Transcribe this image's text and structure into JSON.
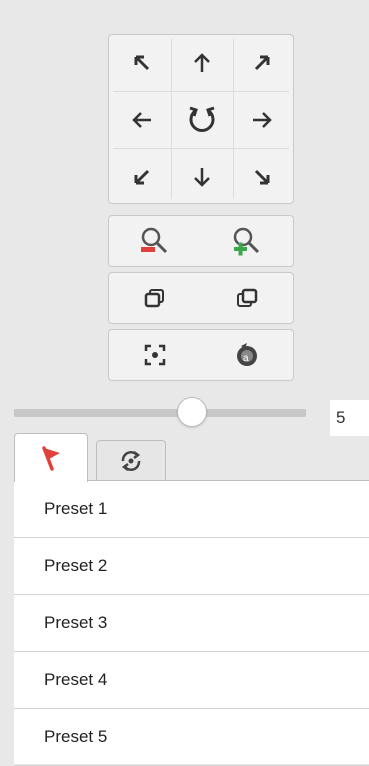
{
  "ptz": {
    "directions": [
      {
        "name": "up-left"
      },
      {
        "name": "up"
      },
      {
        "name": "up-right"
      },
      {
        "name": "left"
      },
      {
        "name": "auto-rotate"
      },
      {
        "name": "right"
      },
      {
        "name": "down-left"
      },
      {
        "name": "down"
      },
      {
        "name": "down-right"
      }
    ],
    "zoom": [
      "zoom-out-icon",
      "zoom-in-icon"
    ],
    "focus": [
      "focus-near-icon",
      "focus-far-icon"
    ],
    "iris": [
      "iris-open-icon",
      "iris-close-icon"
    ],
    "accent_red": "#e0413b",
    "accent_green": "#3aa84a"
  },
  "speed": {
    "value": "5",
    "fraction": 0.61
  },
  "tabs": [
    {
      "icon": "red-flag-icon",
      "active": true
    },
    {
      "icon": "patrol-icon",
      "active": false
    }
  ],
  "presets": [
    {
      "label": "Preset 1"
    },
    {
      "label": "Preset 2"
    },
    {
      "label": "Preset 3"
    },
    {
      "label": "Preset 4"
    },
    {
      "label": "Preset 5"
    }
  ]
}
